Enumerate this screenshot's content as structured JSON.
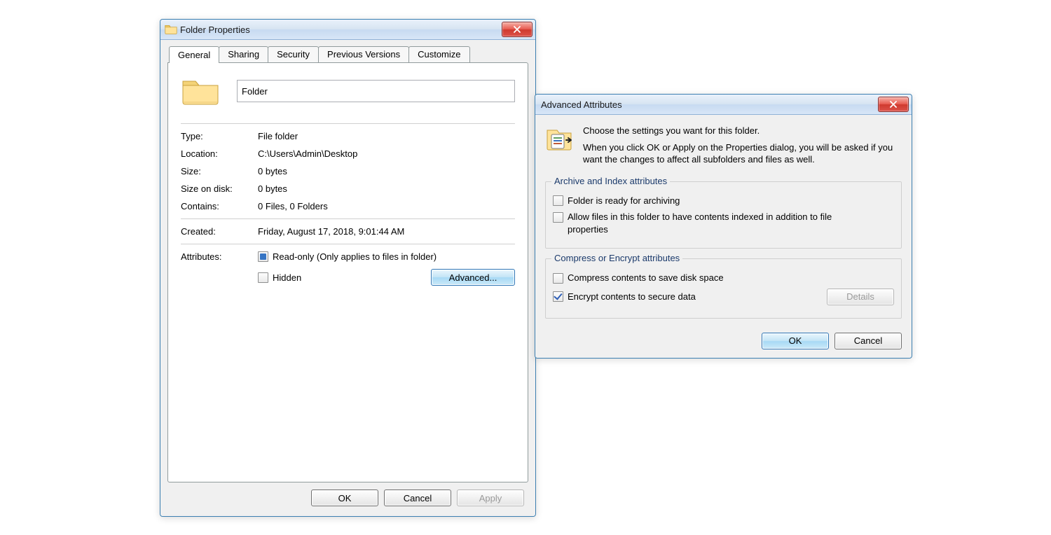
{
  "props": {
    "title": "Folder Properties",
    "tabs": [
      "General",
      "Sharing",
      "Security",
      "Previous Versions",
      "Customize"
    ],
    "active_tab": 0,
    "folder_name": "Folder",
    "rows": {
      "type": {
        "label": "Type:",
        "value": "File folder"
      },
      "location": {
        "label": "Location:",
        "value": "C:\\Users\\Admin\\Desktop"
      },
      "size": {
        "label": "Size:",
        "value": "0 bytes"
      },
      "disk": {
        "label": "Size on disk:",
        "value": "0 bytes"
      },
      "contains": {
        "label": "Contains:",
        "value": "0 Files, 0 Folders"
      },
      "created": {
        "label": "Created:",
        "value": "Friday, August 17, 2018, 9:01:44 AM"
      }
    },
    "attributes_label": "Attributes:",
    "readonly_label": "Read-only (Only applies to files in folder)",
    "hidden_label": "Hidden",
    "advanced_button": "Advanced...",
    "buttons": {
      "ok": "OK",
      "cancel": "Cancel",
      "apply": "Apply"
    }
  },
  "adv": {
    "title": "Advanced Attributes",
    "msg1": "Choose the settings you want for this folder.",
    "msg2": "When you click OK or Apply on the Properties dialog, you will be asked if you want the changes to affect all subfolders and files as well.",
    "group1": {
      "title": "Archive and Index attributes",
      "archive_label": "Folder is ready for archiving",
      "index_label": "Allow files in this folder to have contents indexed in addition to file properties"
    },
    "group2": {
      "title": "Compress or Encrypt attributes",
      "compress_label": "Compress contents to save disk space",
      "encrypt_label": "Encrypt contents to secure data",
      "details_button": "Details"
    },
    "buttons": {
      "ok": "OK",
      "cancel": "Cancel"
    }
  }
}
